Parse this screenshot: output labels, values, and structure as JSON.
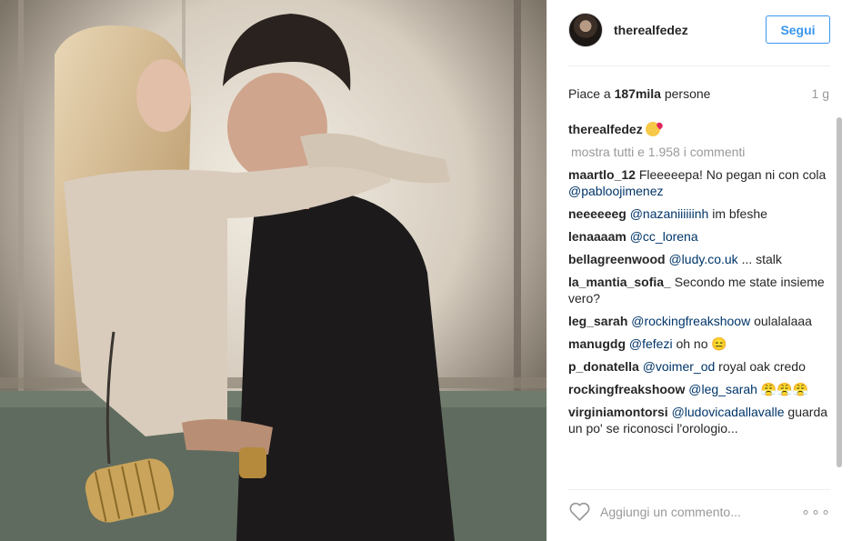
{
  "post": {
    "username": "therealfedez",
    "follow_label": "Segui",
    "likes_prefix": "Piace a ",
    "likes_count": "187mila",
    "likes_suffix": " persone",
    "time": "1 g",
    "caption_user": "therealfedez",
    "caption_emoji": "kissing-face-with-heart",
    "view_all": "mostra tutti e 1.958 i commenti",
    "add_comment_placeholder": "Aggiungi un commento...",
    "more_label": "∘∘∘"
  },
  "comments": [
    {
      "user": "maartlo_12",
      "pre": " Fleeeeepa! No pegan ni con cola ",
      "mention": "@pabloojimenez",
      "post": ""
    },
    {
      "user": "neeeeeeg",
      "pre": " ",
      "mention": "@nazaniiiiiinh",
      "post": " im bfeshe"
    },
    {
      "user": "lenaaaam",
      "pre": " ",
      "mention": "@cc_lorena",
      "post": ""
    },
    {
      "user": "bellagreenwood",
      "pre": " ",
      "mention": "@ludy.co.uk",
      "post": " ... stalk"
    },
    {
      "user": "la_mantia_sofia_",
      "pre": " Secondo me state insieme vero?",
      "mention": "",
      "post": ""
    },
    {
      "user": "leg_sarah",
      "pre": " ",
      "mention": "@rockingfreakshoow",
      "post": " oulalalaaa"
    },
    {
      "user": "manugdg",
      "pre": " ",
      "mention": "@fefezi",
      "post": " oh no 😑"
    },
    {
      "user": "p_donatella",
      "pre": " ",
      "mention": "@voimer_od",
      "post": " royal oak credo"
    },
    {
      "user": "rockingfreakshoow",
      "pre": " ",
      "mention": "@leg_sarah",
      "post": " 😤😤😤"
    },
    {
      "user": "virginiamontorsi",
      "pre": " ",
      "mention": "@ludovicadallavalle",
      "post": " guarda un po' se riconosci l'orologio..."
    }
  ],
  "colors": {
    "accent": "#3897f0",
    "mention": "#003569",
    "muted": "#999999",
    "text": "#262626"
  }
}
